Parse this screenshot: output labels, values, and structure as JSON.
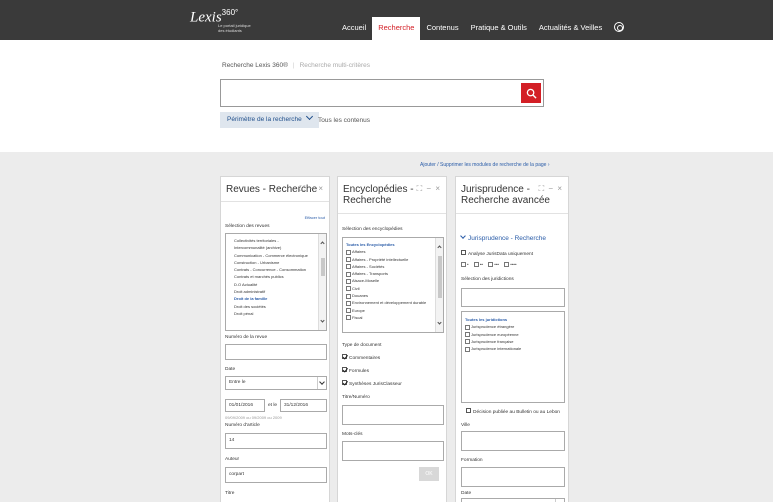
{
  "app": {
    "logo_name": "Lexis",
    "logo_version": "360°",
    "logo_tagline": "Le portail juridique des étudiants"
  },
  "nav": {
    "items": [
      "Accueil",
      "Recherche",
      "Contenus",
      "Pratique & Outils",
      "Actualités & Veilles"
    ],
    "active": "Recherche",
    "user_icon": "user-circle-icon"
  },
  "search": {
    "tab_active": "Recherche Lexis 360®",
    "tab_inactive": "Recherche multi-critères",
    "query": "",
    "button_icon": "search-icon",
    "perimeter_label": "Périmètre de la recherche",
    "perimeter_value": "Tous les contenus"
  },
  "add_link": "Ajouter / Supprimer les modules de recherche de la page ›",
  "panels": {
    "revues": {
      "title": "Revues - Recherche",
      "controls": "⛶ − ×",
      "clear_all": "Effacer tout",
      "select_label": "Sélection des revues",
      "list": [
        "Collectivités territoriales -",
        "Intercommunalité (archive)",
        "Communication - Commerce électronique",
        "Construction - Urbanisme",
        "Contrats - Concurrence - Consommation",
        "Contrats et marchés publics",
        "D.O Actualité",
        "Droit administratif",
        "Droit de la famille",
        "Droit des sociétés",
        "Droit pénal"
      ],
      "highlighted": "Droit de la famille",
      "numero_label": "Numéro de la revue",
      "numero_value": "",
      "date_label": "Date",
      "date_mode": "Entre le",
      "date_from": "01/01/2016",
      "date_and": "et le",
      "date_to": "31/12/2016",
      "date_hint": "09/09/2009 ou 09/2009 ou 2009",
      "article_label": "Numéro d'article",
      "article_value": "14",
      "author_label": "Auteur",
      "author_value": "corpart",
      "title_label": "Titre"
    },
    "encyclopedies": {
      "title_line1": "Encyclopédies -",
      "title_line2": "Recherche",
      "controls": "⛶ − ×",
      "select_label": "Sélection des encyclopédies",
      "list_header": "Toutes les Encyclopédies",
      "list": [
        "Affaires",
        "Affaires - Propriété intellectuelle",
        "Affaires - Sociétés",
        "Affaires - Transports",
        "Alsace-Moselle",
        "Civil",
        "Douanes",
        "Environnement et développement durable",
        "Europe",
        "Fiscal"
      ],
      "doctype_label": "Type de document",
      "doctypes": [
        "Commentaires",
        "Formules",
        "Synthèses JurisClasseur"
      ],
      "titre_label": "Titre/Numéro",
      "mots_label": "Mots-clés",
      "ok_label": "OK"
    },
    "jurisprudence": {
      "title_line1": "Jurisprudence -",
      "title_line2": "Recherche avancée",
      "controls": "⛶ − ×",
      "sub_heading": "Jurisprudence - Recherche",
      "analyse_label": "Analyse JurisData uniquement",
      "stars": [
        "•",
        "••",
        "•••",
        "••••"
      ],
      "select_label": "Sélection des juridictions",
      "list_header": "Toutes les juridictions",
      "list": [
        "Jurisprudence étrangère",
        "Jurisprudence européenne",
        "Jurisprudence française",
        "Jurisprudence internationale"
      ],
      "bulletin_label": "Décision publiée au Bulletin ou au Lebon",
      "ville_label": "Ville",
      "formation_label": "Formation",
      "date_label": "Date"
    }
  }
}
